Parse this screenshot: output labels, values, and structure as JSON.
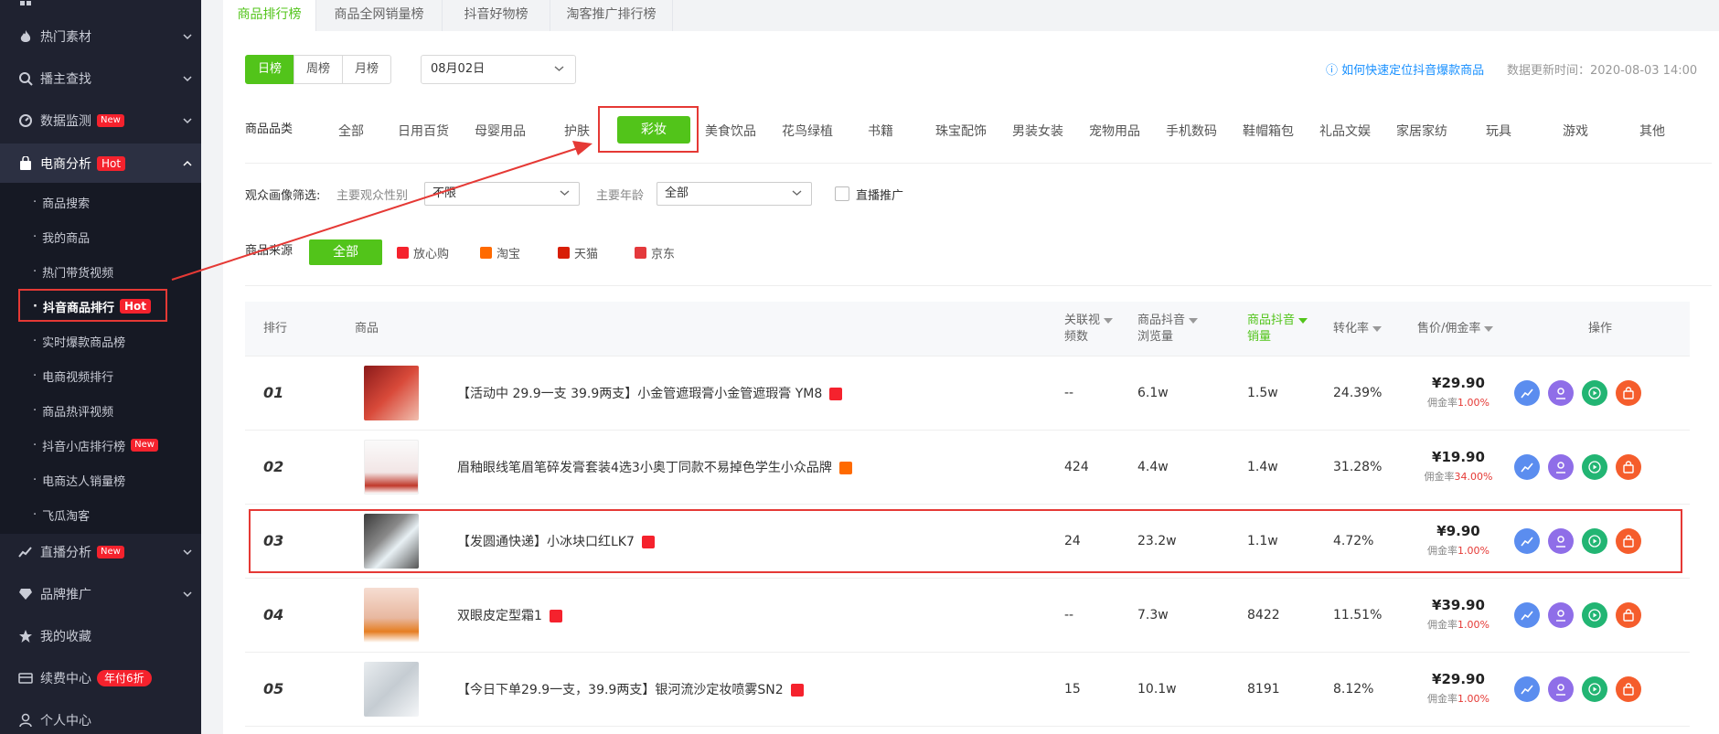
{
  "sidebar": {
    "items": [
      {
        "label": "热门素材",
        "icon": "flame-icon"
      },
      {
        "label": "播主查找",
        "icon": "search-icon"
      },
      {
        "label": "数据监测",
        "icon": "monitor-icon",
        "badge": "New"
      },
      {
        "label": "电商分析",
        "icon": "shopping-bag-icon",
        "badge": "Hot"
      }
    ],
    "sub_items": [
      {
        "label": "商品搜索"
      },
      {
        "label": "我的商品"
      },
      {
        "label": "热门带货视频"
      },
      {
        "label": "抖音商品排行",
        "badge": "Hot"
      },
      {
        "label": "实时爆款商品榜"
      },
      {
        "label": "电商视频排行"
      },
      {
        "label": "商品热评视频"
      },
      {
        "label": "抖音小店排行榜",
        "badge": "New"
      },
      {
        "label": "电商达人销量榜"
      },
      {
        "label": "飞瓜淘客"
      }
    ],
    "bottom_items": [
      {
        "label": "直播分析",
        "icon": "live-chart-icon",
        "badge": "New"
      },
      {
        "label": "品牌推广",
        "icon": "diamond-icon"
      },
      {
        "label": "我的收藏",
        "icon": "star-icon"
      },
      {
        "label": "续费中心",
        "icon": "card-icon",
        "badge": "年付6折"
      },
      {
        "label": "个人中心",
        "icon": "user-icon"
      }
    ]
  },
  "tabs": [
    {
      "label": "商品排行榜"
    },
    {
      "label": "商品全网销量榜"
    },
    {
      "label": "抖音好物榜"
    },
    {
      "label": "淘客推广排行榜"
    }
  ],
  "period": {
    "day": "日榜",
    "week": "周榜",
    "month": "月榜"
  },
  "date": {
    "value": "08月02日"
  },
  "help_link": "如何快速定位抖音爆款商品",
  "update_time": "数据更新时间：2020-08-03 14:00",
  "category": {
    "label": "商品品类",
    "selected": "彩妆",
    "items": [
      "全部",
      "日用百货",
      "母婴用品",
      "护肤",
      "彩妆",
      "美食饮品",
      "花鸟绿植",
      "书籍",
      "珠宝配饰",
      "男装女装",
      "宠物用品",
      "手机数码",
      "鞋帽箱包",
      "礼品文娱",
      "家居家纺",
      "玩具",
      "游戏",
      "其他"
    ]
  },
  "audience": {
    "label": "观众画像筛选:",
    "gender_label": "主要观众性别",
    "gender_value": "不限",
    "age_label": "主要年龄",
    "age_value": "全部",
    "live_label": "直播推广"
  },
  "source": {
    "label": "商品来源",
    "all": "全部",
    "items": [
      {
        "label": "放心购",
        "color": "#f5222d"
      },
      {
        "label": "淘宝",
        "color": "#ff6a00"
      },
      {
        "label": "天猫",
        "color": "#d81e06"
      },
      {
        "label": "京东",
        "color": "#e4393c"
      }
    ]
  },
  "table": {
    "headers": {
      "rank": "排行",
      "product": "商品",
      "videos_1": "关联视",
      "videos_2": "频数",
      "views_1": "商品抖音",
      "views_2": "浏览量",
      "sales_1": "商品抖音",
      "sales_2": "销量",
      "conversion": "转化率",
      "price": "售价/佣金率",
      "ops": "操作"
    },
    "commission_prefix": "佣金率",
    "rows": [
      {
        "rank": "01",
        "name": "【活动中 29.9一支 39.9两支】小金管遮瑕膏小金管遮瑕膏 YM8",
        "videos": "--",
        "views": "6.1w",
        "sales": "1.5w",
        "conversion": "24.39%",
        "price": "¥29.90",
        "commission": "1.00%",
        "platform_color": "#f5222d"
      },
      {
        "rank": "02",
        "name": "眉釉眼线笔眉笔碎发膏套装4选3小奥丁同款不易掉色学生小众品牌",
        "videos": "424",
        "views": "4.4w",
        "sales": "1.4w",
        "conversion": "31.28%",
        "price": "¥19.90",
        "commission": "34.00%",
        "platform_color": "#ff6a00"
      },
      {
        "rank": "03",
        "name": "【发圆通快递】小冰块口红LK7",
        "videos": "24",
        "views": "23.2w",
        "sales": "1.1w",
        "conversion": "4.72%",
        "price": "¥9.90",
        "commission": "1.00%",
        "platform_color": "#f5222d"
      },
      {
        "rank": "04",
        "name": "双眼皮定型霜1",
        "videos": "--",
        "views": "7.3w",
        "sales": "8422",
        "conversion": "11.51%",
        "price": "¥39.90",
        "commission": "1.00%",
        "platform_color": "#f5222d"
      },
      {
        "rank": "05",
        "name": "【今日下单29.9一支，39.9两支】银河流沙定妆喷雾SN2",
        "videos": "15",
        "views": "10.1w",
        "sales": "8191",
        "conversion": "8.12%",
        "price": "¥29.90",
        "commission": "1.00%",
        "platform_color": "#f5222d"
      }
    ]
  },
  "colors": {
    "accent": "#52c41a",
    "highlight": "#e53935",
    "sidebar_bg": "#1f2230"
  }
}
